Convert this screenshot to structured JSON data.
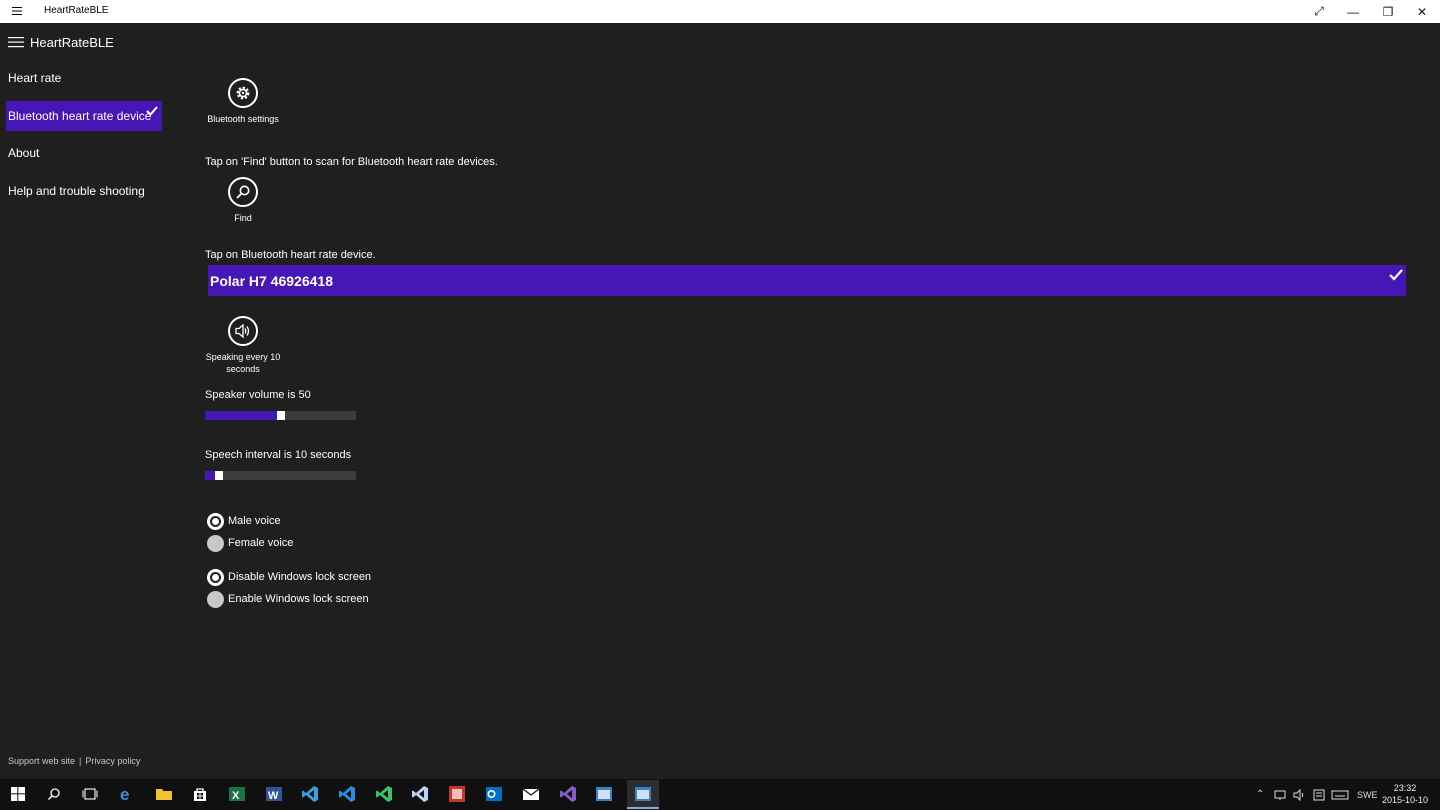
{
  "window": {
    "title": "HeartRateBLE"
  },
  "nav": {
    "app_name": "HeartRateBLE",
    "items": [
      {
        "label": "Heart rate"
      },
      {
        "label": "Bluetooth heart rate device"
      },
      {
        "label": "About"
      },
      {
        "label": "Help and trouble shooting"
      }
    ],
    "footer": {
      "support": "Support web site",
      "separator": "|",
      "privacy": "Privacy policy"
    }
  },
  "main": {
    "bluetooth_settings_label": "Bluetooth settings",
    "find_instruction": "Tap on 'Find' button to scan for Bluetooth heart rate devices.",
    "find_label": "Find",
    "tap_instruction": "Tap on Bluetooth heart rate device.",
    "device_name": "Polar H7 46926418",
    "speaking_label": "Speaking every 10 seconds",
    "volume_label": "Speaker volume is 50",
    "volume_value": 50,
    "interval_label": "Speech interval is 10 seconds",
    "interval_fraction": 0.07,
    "voice_options": [
      {
        "label": "Male voice",
        "selected": true
      },
      {
        "label": "Female voice",
        "selected": false
      }
    ],
    "lock_options": [
      {
        "label": "Disable Windows lock screen",
        "selected": true
      },
      {
        "label": "Enable Windows lock screen",
        "selected": false
      }
    ]
  },
  "taskbar": {
    "language": "SWE",
    "time": "23:32",
    "date": "2015-10-10"
  },
  "colors": {
    "accent": "#4617b4",
    "background": "#1f1f1f"
  }
}
